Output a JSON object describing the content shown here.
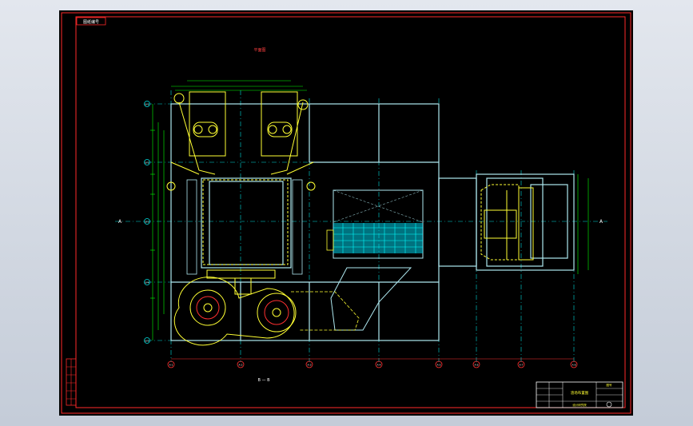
{
  "drawing": {
    "corner_tag": "图纸编号",
    "plan_title": "平面图",
    "section_label": "B — B",
    "axis_section_left": "A",
    "axis_section_right": "A"
  },
  "grid": {
    "bottom_labels": [
      "A-1",
      "A-2",
      "A-3",
      "A-4",
      "A-5",
      "A-6",
      "A-7",
      "A-8"
    ],
    "left_labels": [
      "B-1",
      "B-2",
      "B-3",
      "B-4",
      "B-5"
    ]
  },
  "title_block": {
    "project": "渣场布置图",
    "drawing_no": "图号",
    "company": "设计研究院"
  },
  "colors": {
    "background": "#000000",
    "frame": "#ff2a2a",
    "structure": "#aee8f0",
    "equipment": "#ffff33",
    "dimension": "#00ff00",
    "grid_line": "#00dcdc",
    "hatch": "#00e5ff"
  }
}
